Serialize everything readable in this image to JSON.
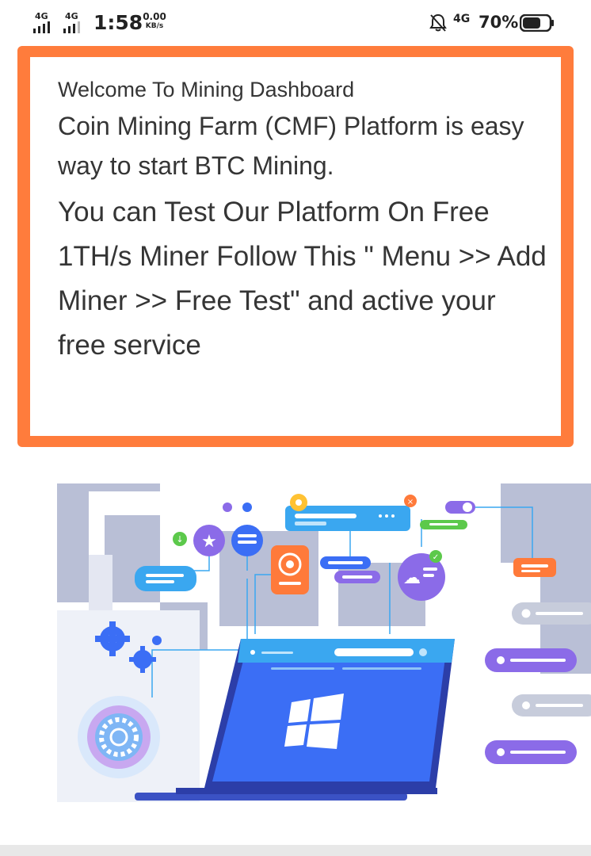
{
  "status_bar": {
    "sim1_network": "4G",
    "sim2_network": "4G",
    "time": "1:58",
    "speed_value": "0.00",
    "speed_unit": "KB/s",
    "mute_icon": "bell-off-icon",
    "data_network": "4G",
    "battery_percent": "70%",
    "battery_level": 0.7
  },
  "welcome_card": {
    "heading": "Welcome To Mining Dashboard",
    "intro": "Coin Mining Farm (CMF) Platform is easy way to start BTC Mining.",
    "instructions": "You can Test Our Platform On Free 1TH/s Miner Follow This \" Menu >> Add Miner >> Free Test\" and active your free service",
    "border_color": "#ff7c3c"
  },
  "illustration": {
    "description_icon": "laptop-windows-illustration",
    "colors": {
      "primary_blue": "#3b6ef5",
      "sky_blue": "#3aa7f0",
      "purple": "#8b6be8",
      "orange": "#ff7a3a",
      "green": "#5cc94b",
      "gray_building": "#b9bfd6"
    }
  }
}
